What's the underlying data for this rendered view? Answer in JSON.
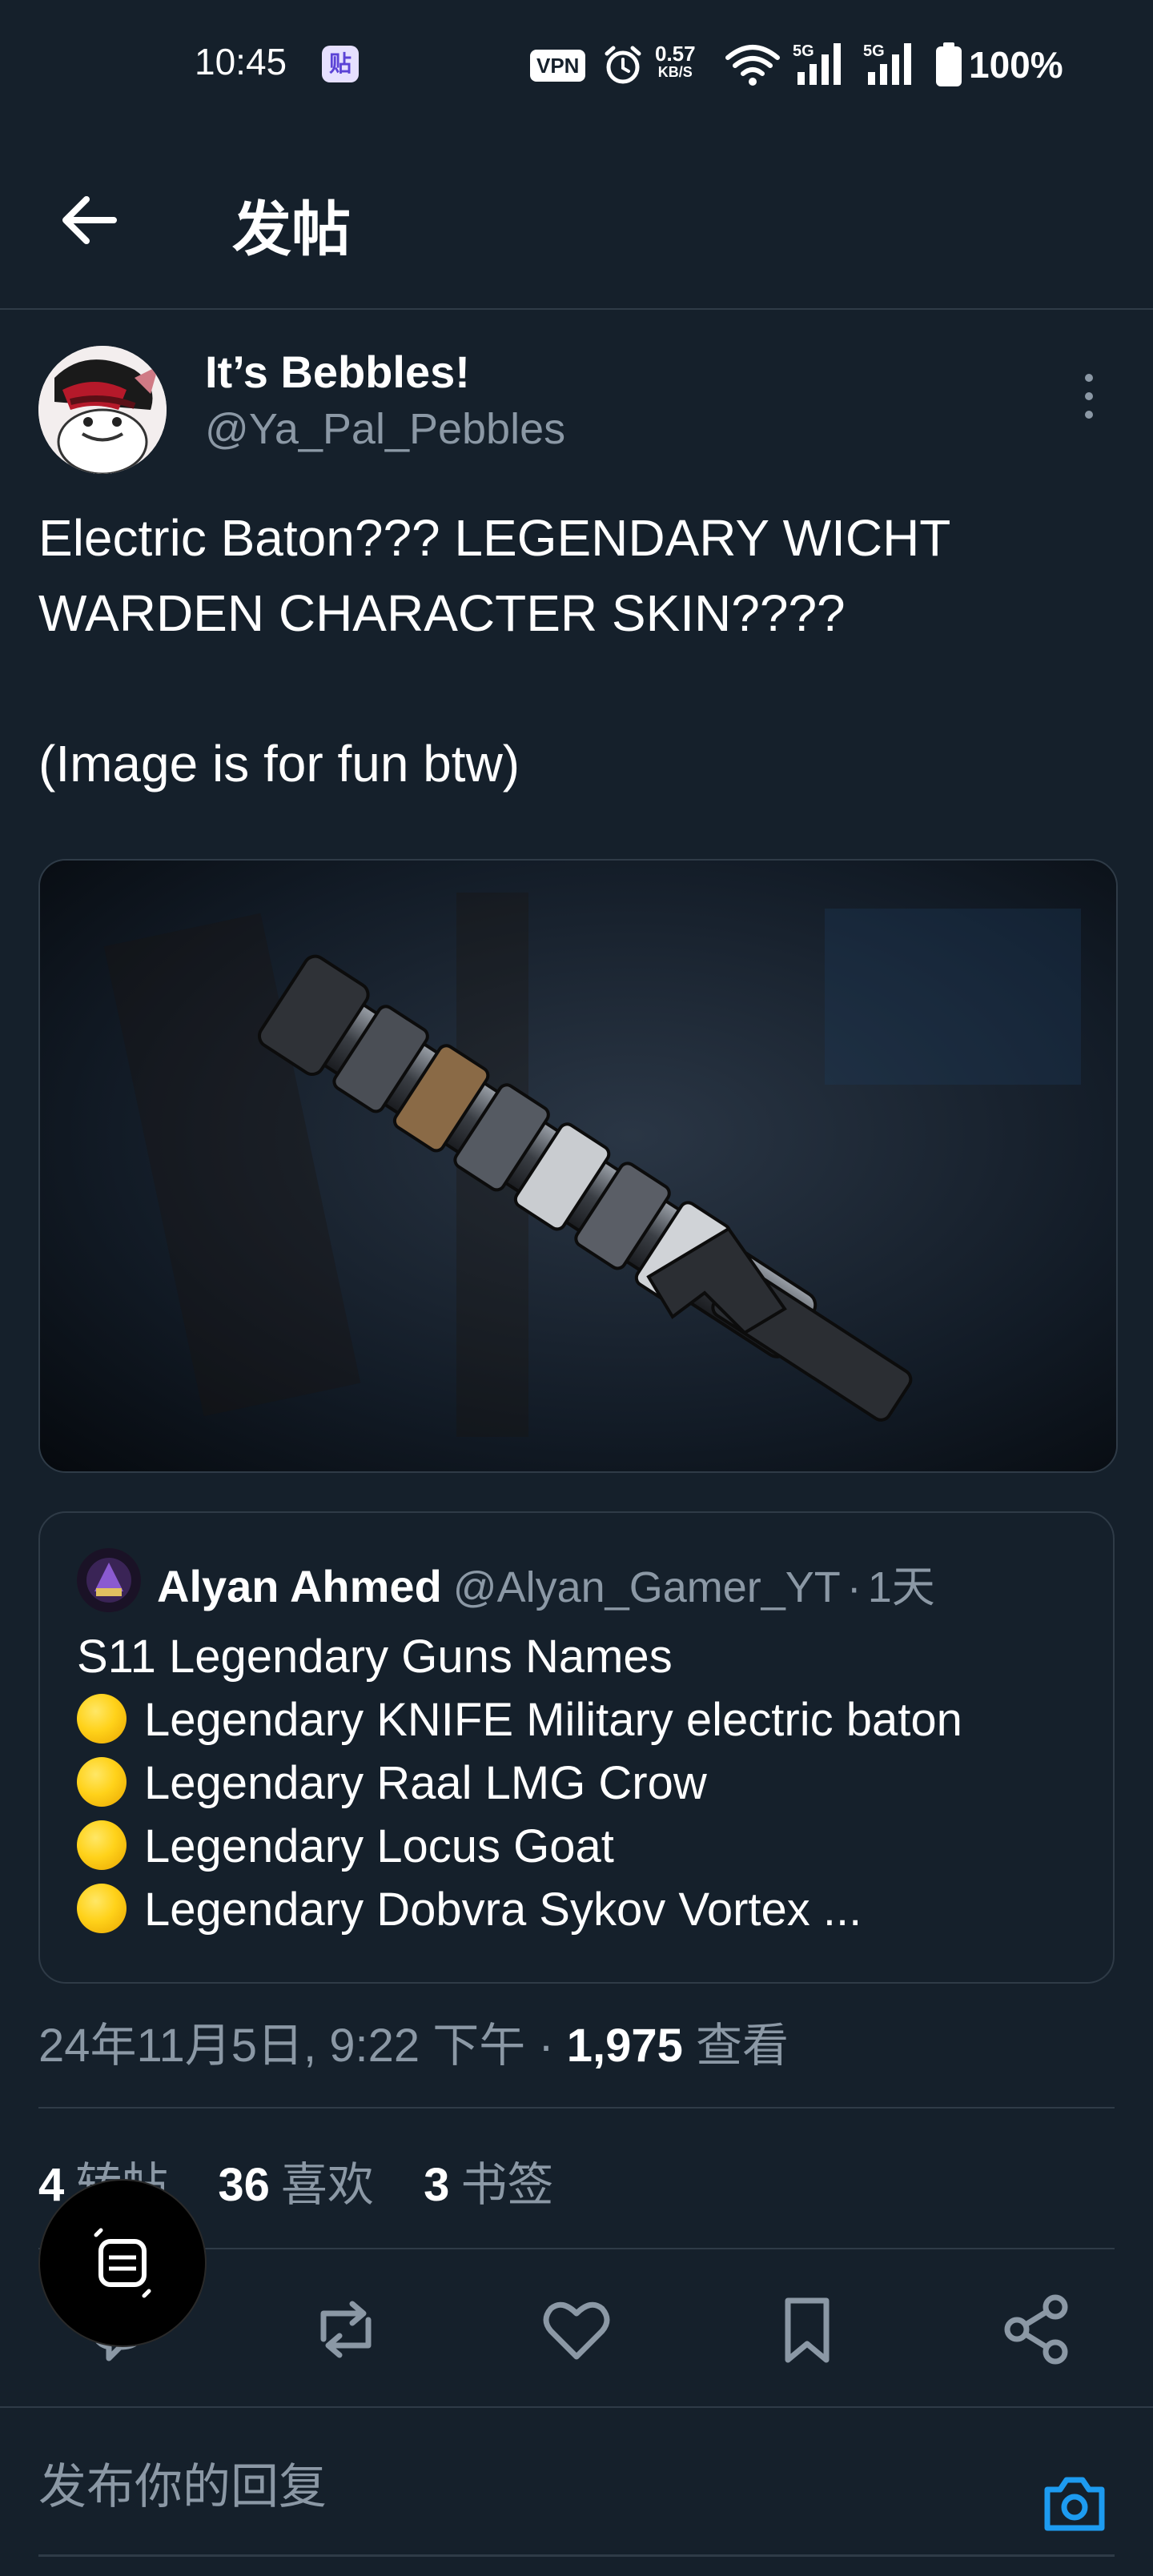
{
  "status_bar": {
    "time": "10:45",
    "app_badge": "贴",
    "vpn": "VPN",
    "speed_value": "0.57",
    "speed_unit": "KB/S",
    "network_1": "5G",
    "network_2": "5G",
    "battery": "100%"
  },
  "header": {
    "title": "发帖"
  },
  "tweet": {
    "author_name": "It’s Bebbles!",
    "author_handle": "@Ya_Pal_Pebbles",
    "text": "Electric Baton??? LEGENDARY WICHT\nWARDEN CHARACTER SKIN????\n\n(Image is for fun btw)",
    "timestamp": "24年11月5日, 9:22 下午 · ",
    "views_count": "1,975",
    "views_label": " 查看"
  },
  "quote": {
    "author_name": "Alyan Ahmed",
    "author_handle": "@Alyan_Gamer_YT",
    "separator": "·",
    "time": "1天",
    "title_line": "S11 Legendary Guns Names",
    "lines": [
      "Legendary KNIFE Military electric baton",
      "Legendary Raal LMG Crow",
      "Legendary Locus Goat",
      "Legendary Dobvra Sykov Vortex ..."
    ]
  },
  "stats": {
    "reposts_count": "4",
    "reposts_label": "转帖",
    "likes_count": "36",
    "likes_label": "喜欢",
    "bookmarks_count": "3",
    "bookmarks_label": "书签"
  },
  "reply": {
    "placeholder": "发布你的回复"
  },
  "colors": {
    "background": "#15202b",
    "divider": "#2f3b47",
    "secondary_text": "#8b98a5",
    "accent": "#1d9bf0"
  }
}
